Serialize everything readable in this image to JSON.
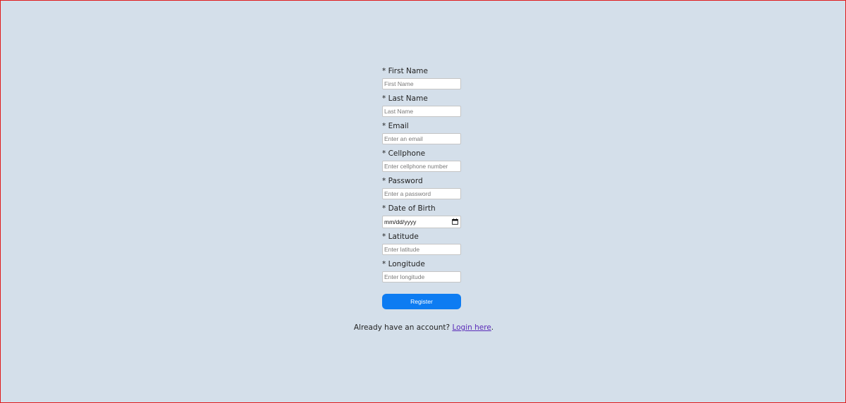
{
  "form": {
    "fields": [
      {
        "label": "* First Name",
        "placeholder": "First Name"
      },
      {
        "label": "* Last Name",
        "placeholder": "Last Name"
      },
      {
        "label": "* Email",
        "placeholder": "Enter an email"
      },
      {
        "label": "* Cellphone",
        "placeholder": "Enter cellphone number"
      },
      {
        "label": "* Password",
        "placeholder": "Enter a password"
      }
    ],
    "dob": {
      "label": "* Date of Birth",
      "value": "mm/dd/yyyy"
    },
    "latitude": {
      "label": "* Latitude",
      "placeholder": "Enter latitude"
    },
    "longitude": {
      "label": "* Longitude",
      "placeholder": "Enter longitude"
    },
    "register_label": "Register"
  },
  "footer": {
    "text": "Already have an account?",
    "link_text": "Login here",
    "suffix": "."
  },
  "colors": {
    "background": "#d4dfea",
    "border": "#e01b1b",
    "button": "#0d7cf2",
    "link": "#5a2ab8"
  }
}
